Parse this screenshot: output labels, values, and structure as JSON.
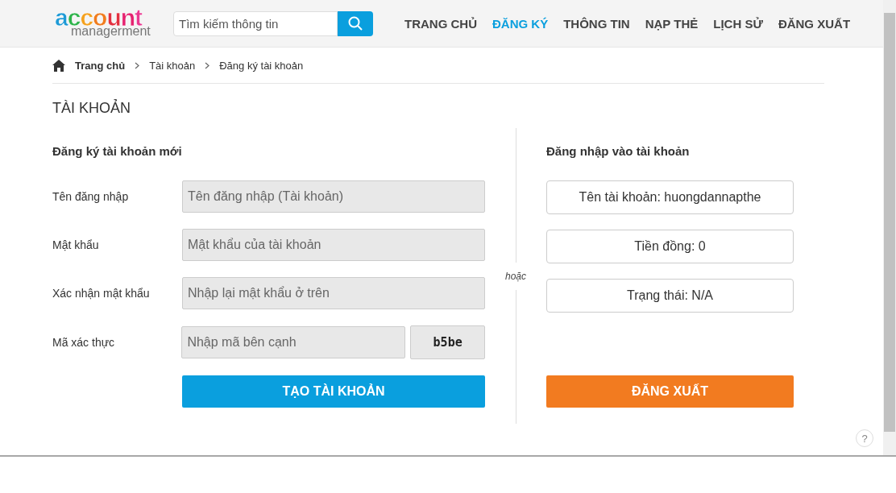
{
  "logo": {
    "title": "account",
    "subtitle": "managerment"
  },
  "search": {
    "placeholder": "Tìm kiếm thông tin"
  },
  "nav": [
    {
      "label": "TRANG CHỦ",
      "selected": false
    },
    {
      "label": "ĐĂNG KÝ",
      "selected": true
    },
    {
      "label": "THÔNG TIN",
      "selected": false
    },
    {
      "label": "NẠP THẺ",
      "selected": false
    },
    {
      "label": "LỊCH SỬ",
      "selected": false
    },
    {
      "label": "ĐĂNG XUẤT",
      "selected": false
    }
  ],
  "breadcrumb": [
    "Trang chủ",
    "Tài khoản",
    "Đăng ký tài khoản"
  ],
  "page_title": "TÀI KHOẢN",
  "register": {
    "heading": "Đăng ký tài khoản mới",
    "fields": [
      {
        "label": "Tên đăng nhập",
        "placeholder": "Tên đăng nhập (Tài khoản)"
      },
      {
        "label": "Mật khẩu",
        "placeholder": "Mật khẩu của tài khoản"
      },
      {
        "label": "Xác nhận mật khẩu",
        "placeholder": "Nhập lại mật khẩu ở trên"
      },
      {
        "label": "Mã xác thực",
        "placeholder": "Nhập mã bên cạnh",
        "captcha": "b5be"
      }
    ],
    "button": "TẠO TÀI KHOẢN"
  },
  "divider_text": "hoặc",
  "login": {
    "heading": "Đăng nhập vào tài khoản",
    "info": [
      "Tên tài khoản: huongdannapthe",
      "Tiền đồng: 0",
      "Trạng thái: N/A"
    ],
    "button": "ĐĂNG XUẤT"
  },
  "help": "?"
}
